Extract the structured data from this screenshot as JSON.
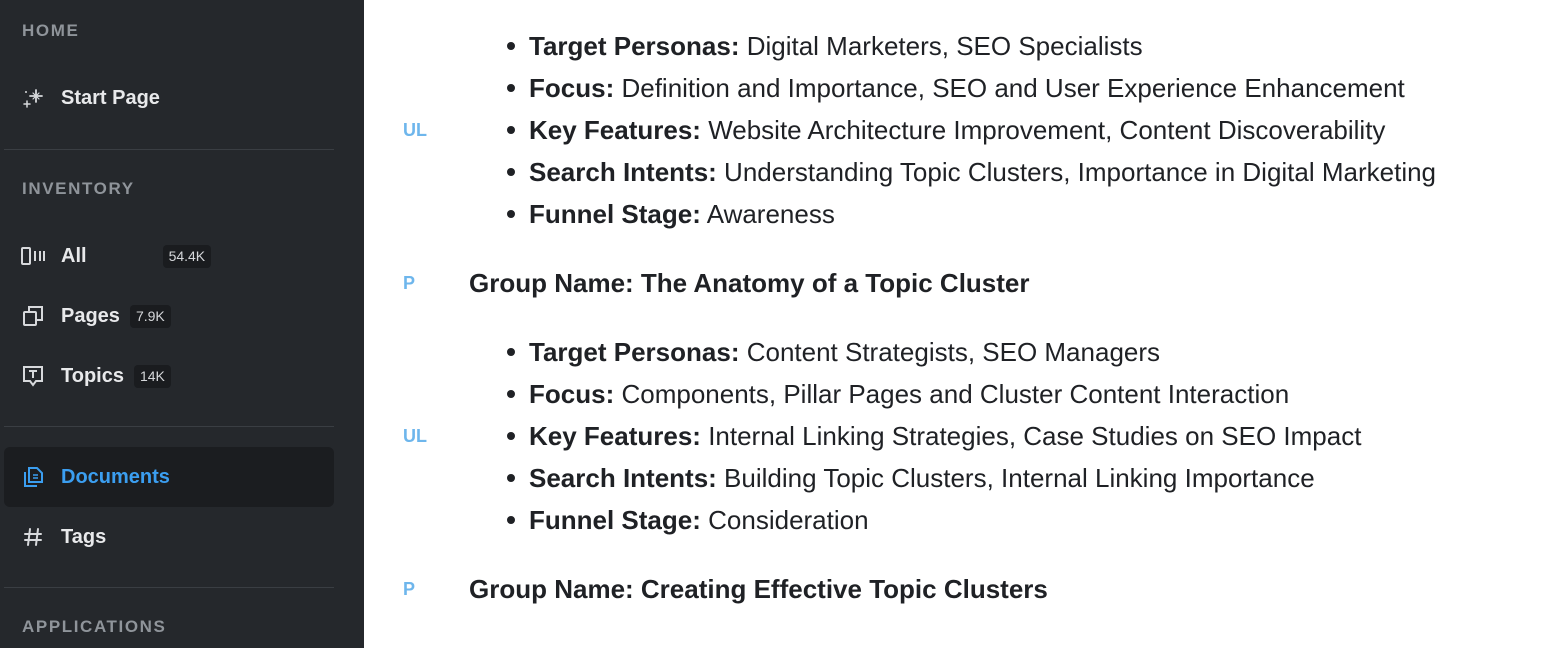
{
  "sidebar": {
    "sections": [
      {
        "header": "HOME"
      },
      {
        "header": "INVENTORY"
      },
      {
        "header": "APPLICATIONS"
      }
    ],
    "items": [
      {
        "label": "Start Page",
        "icon": "sparkle-icon"
      },
      {
        "label": "All",
        "badge": "54.4K",
        "icon": "columns-icon"
      },
      {
        "label": "Pages",
        "badge": "7.9K",
        "icon": "pages-icon"
      },
      {
        "label": "Topics",
        "badge": "14K",
        "icon": "topic-icon"
      },
      {
        "label": "Documents",
        "icon": "document-icon",
        "active": true
      },
      {
        "label": "Tags",
        "icon": "hash-icon"
      }
    ],
    "colors": {
      "background": "#25282c",
      "active_background": "#1b1d20",
      "active_text": "#3b9ef0"
    }
  },
  "content": {
    "blocks": [
      {
        "tag": "UL",
        "items": [
          {
            "key": "Target Personas:",
            "value": " Digital Marketers, SEO Specialists"
          },
          {
            "key": "Focus:",
            "value": " Definition and Importance, SEO and User Experience Enhancement"
          },
          {
            "key": "Key Features:",
            "value": " Website Architecture Improvement, Content Discoverability"
          },
          {
            "key": "Search Intents:",
            "value": " Understanding Topic Clusters, Importance in Digital Marketing"
          },
          {
            "key": "Funnel Stage:",
            "value": " Awareness"
          }
        ]
      },
      {
        "tag": "P",
        "text": "Group Name: The Anatomy of a Topic Cluster"
      },
      {
        "tag": "UL",
        "items": [
          {
            "key": "Target Personas:",
            "value": " Content Strategists, SEO Managers"
          },
          {
            "key": "Focus:",
            "value": " Components, Pillar Pages and Cluster Content Interaction"
          },
          {
            "key": "Key Features:",
            "value": " Internal Linking Strategies, Case Studies on SEO Impact"
          },
          {
            "key": "Search Intents:",
            "value": " Building Topic Clusters, Internal Linking Importance"
          },
          {
            "key": "Funnel Stage:",
            "value": " Consideration"
          }
        ]
      },
      {
        "tag": "P",
        "text": "Group Name: Creating Effective Topic Clusters"
      }
    ],
    "colors": {
      "tag": "#6eb6ec",
      "text": "#1f2125"
    }
  }
}
